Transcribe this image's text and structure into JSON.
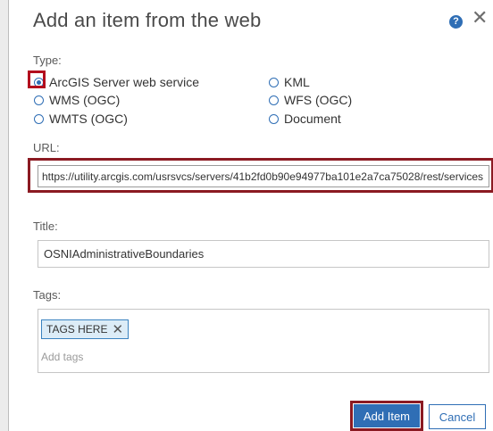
{
  "dialog": {
    "title": "Add an item from the web",
    "help_glyph": "?",
    "close_glyph": "✕"
  },
  "type_section": {
    "label": "Type:",
    "selected": "ArcGIS Server web service",
    "options": [
      "ArcGIS Server web service",
      "KML",
      "WMS (OGC)",
      "WFS (OGC)",
      "WMTS (OGC)",
      "Document"
    ]
  },
  "url_section": {
    "label": "URL:",
    "value": "https://utility.arcgis.com/usrsvcs/servers/41b2fd0b90e94977ba101e2a7ca75028/rest/services"
  },
  "title_section": {
    "label": "Title:",
    "value": "OSNIAdministrativeBoundaries"
  },
  "tags_section": {
    "label": "Tags:",
    "tags": [
      "TAGS HERE"
    ],
    "remove_glyph": "✕",
    "placeholder": "Add tags"
  },
  "buttons": {
    "add_label": "Add Item",
    "cancel_label": "Cancel"
  },
  "colors": {
    "accent": "#2f6eb5",
    "highlight": "#b30e1e"
  }
}
